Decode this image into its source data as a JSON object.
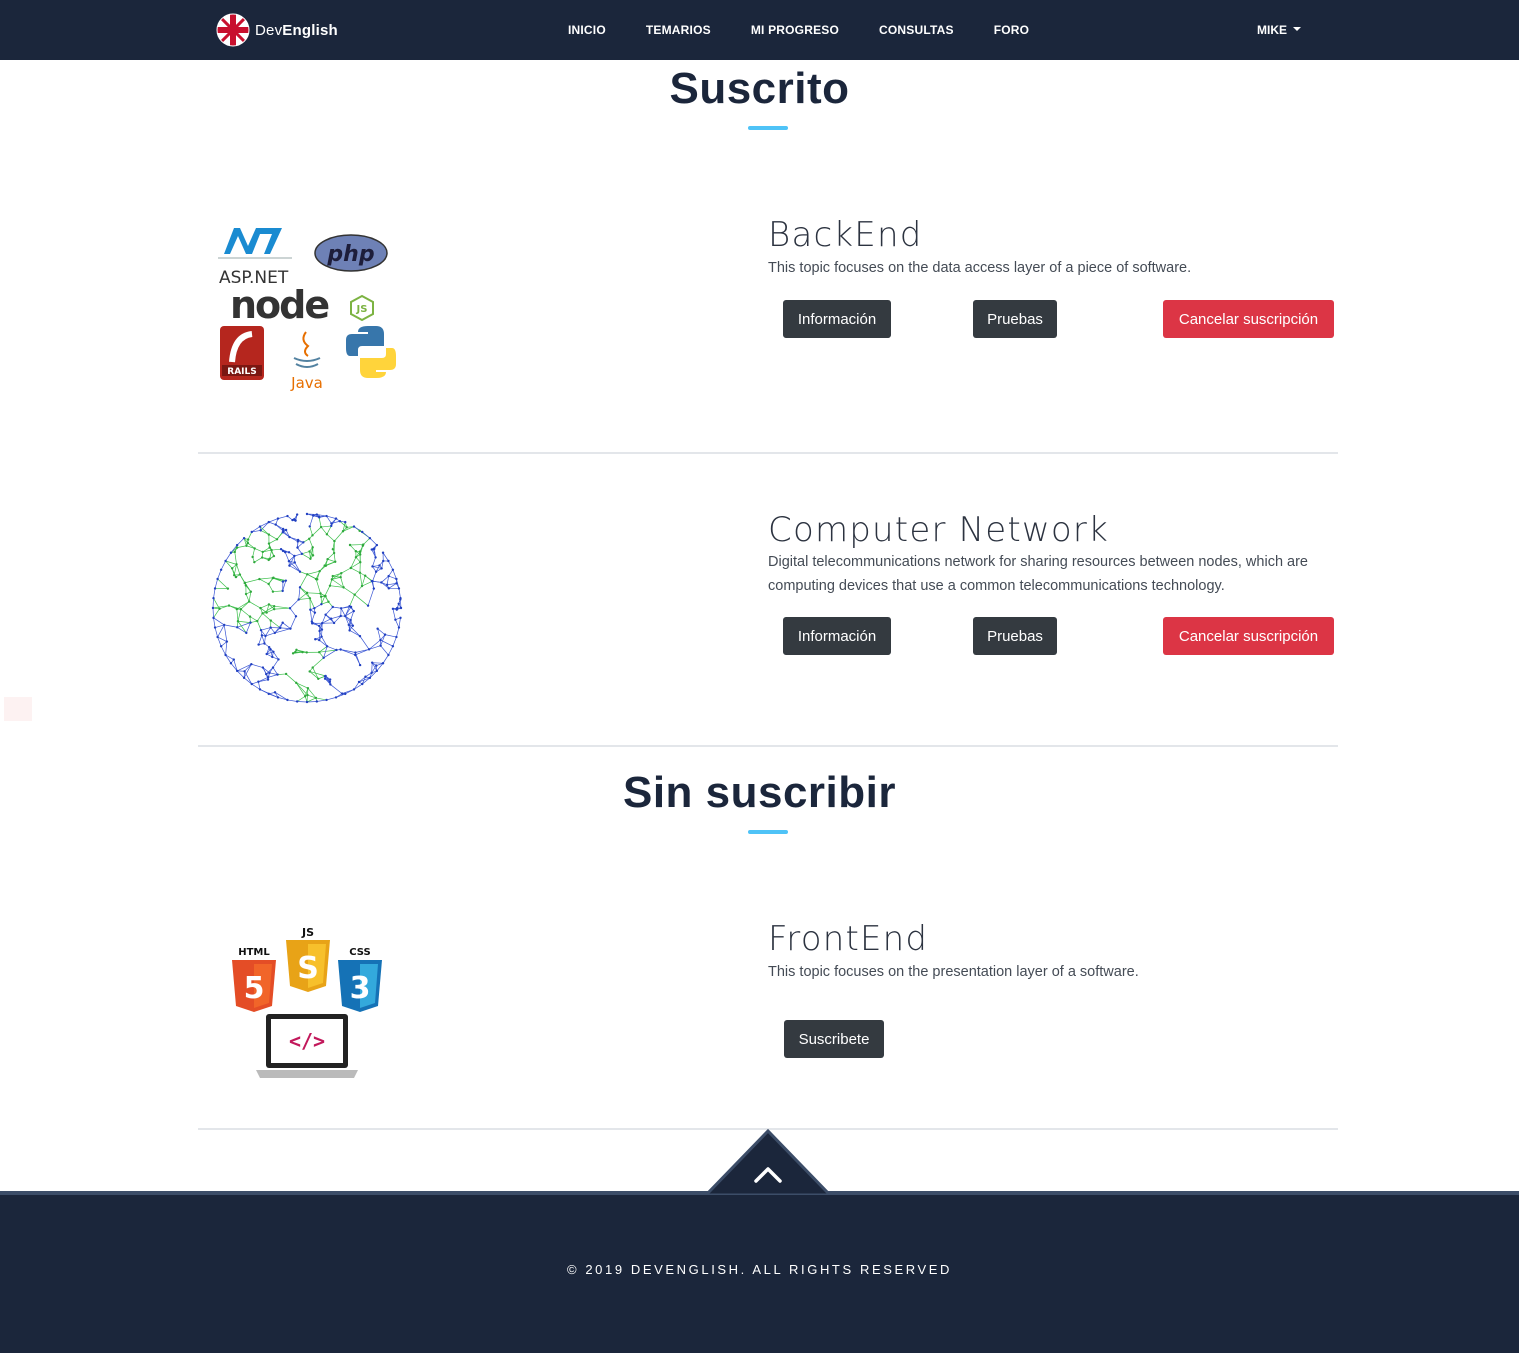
{
  "navbar": {
    "brand_prefix": "Dev",
    "brand_suffix": "English",
    "links": [
      "INICIO",
      "TEMARIOS",
      "MI PROGRESO",
      "CONSULTAS",
      "FORO"
    ],
    "user": "MIKE"
  },
  "subscribed": {
    "heading": "Suscrito",
    "topics": [
      {
        "name": "BackEnd",
        "description": "This topic focuses on the data access layer of a piece of software.",
        "info_button": "Información",
        "tests_button": "Pruebas",
        "cancel_button": "Cancelar suscripción",
        "image_labels": {
          "asp": "ASP.NET",
          "php": "php",
          "node": "node",
          "js": "JS",
          "rails": "RAILS",
          "java": "Java"
        }
      },
      {
        "name": "Computer Network",
        "description": "Digital telecommunications network for sharing resources between nodes, which are computing devices that use a common telecommunications technology.",
        "info_button": "Información",
        "tests_button": "Pruebas",
        "cancel_button": "Cancelar suscripción"
      }
    ]
  },
  "unsubscribed": {
    "heading": "Sin suscribir",
    "topics": [
      {
        "name": "FrontEnd",
        "description": "This topic focuses on the presentation layer of a software.",
        "subscribe_button": "Suscribete",
        "image_labels": {
          "html": "HTML",
          "js": "JS",
          "css": "CSS",
          "html_num": "5",
          "js_num": "S",
          "css_num": "3",
          "code": "</>"
        }
      }
    ]
  },
  "footer": {
    "copyright": "© 2019 DEVENGLISH. ALL RIGHTS RESERVED"
  },
  "colors": {
    "navy": "#1b263b",
    "accent": "#4fc3f7",
    "danger": "#dc3545",
    "dark_button": "#343a40"
  }
}
